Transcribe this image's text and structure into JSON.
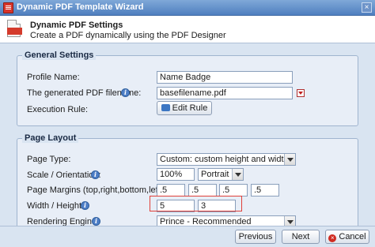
{
  "window": {
    "title": "Dynamic PDF Template Wizard",
    "icon": "pdf-app-icon",
    "close_glyph": "×"
  },
  "header": {
    "title": "Dynamic PDF Settings",
    "subtitle": "Create a PDF dynamically using the PDF Designer"
  },
  "general": {
    "legend": "General Settings",
    "profile_name": {
      "label": "Profile Name:",
      "value": "Name Badge"
    },
    "filename": {
      "label": "The generated PDF filename:",
      "value": "basefilename.pdf"
    },
    "execution_rule": {
      "label": "Execution Rule:",
      "button": "Edit Rule"
    }
  },
  "layout": {
    "legend": "Page Layout",
    "page_type": {
      "label": "Page Type:",
      "value": "Custom: custom height and width"
    },
    "scale": {
      "label": "Scale / Orientation:",
      "scale_value": "100%",
      "orientation_value": "Portrait"
    },
    "margins": {
      "label": "Page Margins (top,right,bottom,left):",
      "values": [
        ".5",
        ".5",
        ".5",
        ".5"
      ]
    },
    "size": {
      "label": "Width / Height:",
      "width": "5",
      "height": "3"
    },
    "engine": {
      "label": "Rendering Engine:",
      "value": "Prince - Recommended"
    }
  },
  "footer": {
    "previous": "Previous",
    "next": "Next",
    "cancel": "Cancel"
  },
  "colors": {
    "titlebar": "#4f7fbf",
    "panel": "#d9e4f1",
    "highlight": "#e0403a"
  },
  "info_glyph": "i"
}
